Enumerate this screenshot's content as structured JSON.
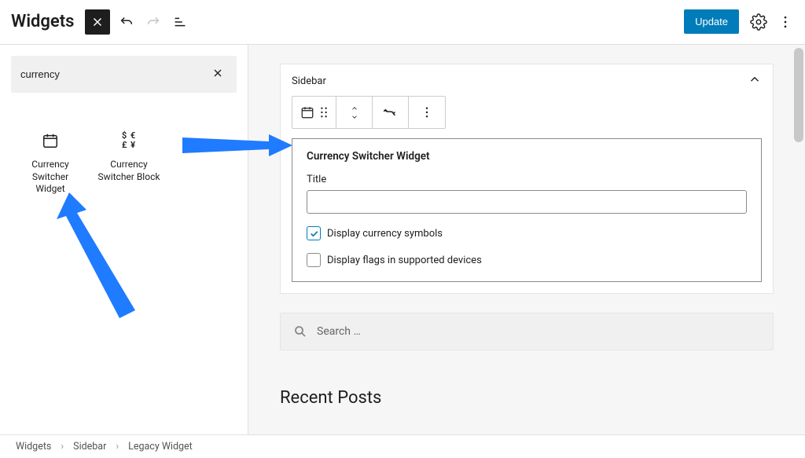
{
  "header": {
    "title": "Widgets",
    "update_label": "Update"
  },
  "search": {
    "value": "currency"
  },
  "blocks": [
    {
      "label": "Currency Switcher Widget",
      "icon": "calendar"
    },
    {
      "label": "Currency Switcher Block",
      "icon": "currency-grid"
    }
  ],
  "sidebar_area": {
    "label": "Sidebar"
  },
  "widget": {
    "heading": "Currency Switcher Widget",
    "title_label": "Title",
    "title_value": "",
    "opt_symbols": "Display currency symbols",
    "opt_flags": "Display flags in supported devices",
    "symbols_checked": true,
    "flags_checked": false
  },
  "search_widget": {
    "placeholder": "Search …"
  },
  "recent_posts": {
    "heading": "Recent Posts"
  },
  "breadcrumb": {
    "a": "Widgets",
    "b": "Sidebar",
    "c": "Legacy Widget"
  }
}
